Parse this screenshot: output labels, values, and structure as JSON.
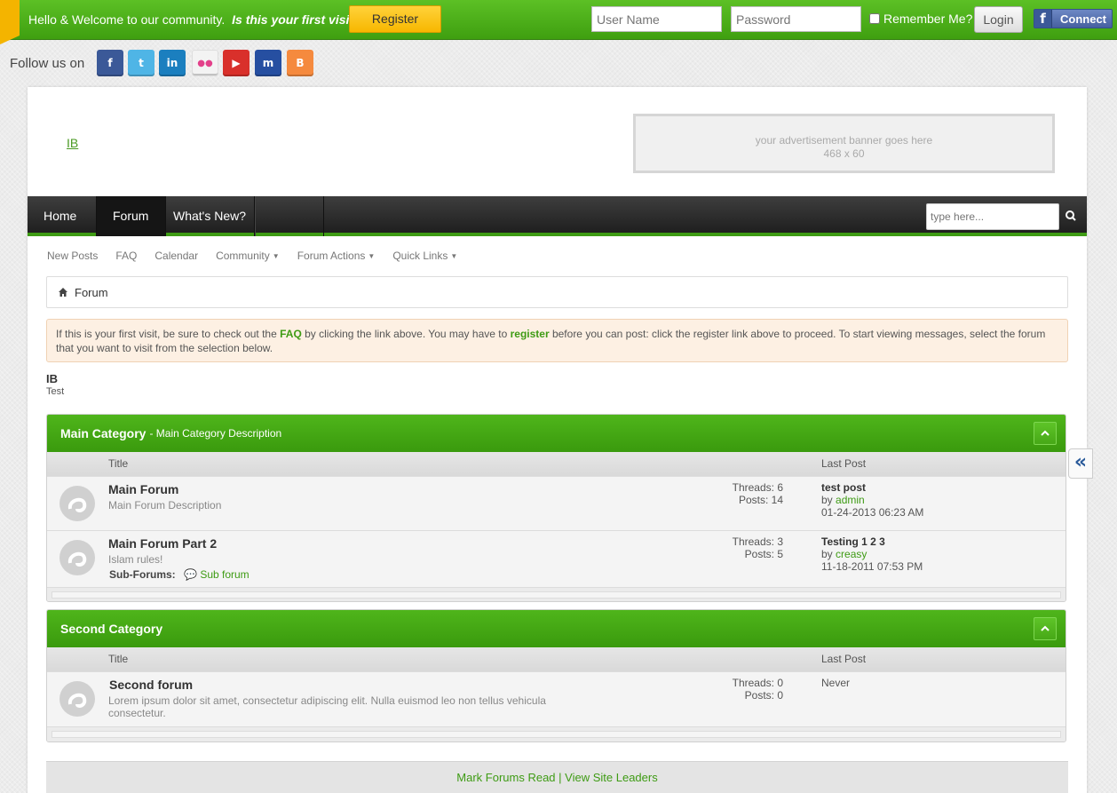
{
  "topbar": {
    "welcome": "Hello & Welcome to our community.",
    "first_visit": "Is this your first visit?",
    "register_label": "Register",
    "username_placeholder": "User Name",
    "password_placeholder": "Password",
    "remember_label": "Remember Me?",
    "remember_checked": false,
    "login_label": "Login",
    "fb_connect_label": "Connect",
    "fb_icon": "f"
  },
  "follow": {
    "label": "Follow us on",
    "networks": [
      {
        "name": "facebook",
        "glyph": "f",
        "color": "#3b5998"
      },
      {
        "name": "twitter",
        "glyph": "t",
        "color": "#4fb5e6"
      },
      {
        "name": "linkedin",
        "glyph": "in",
        "color": "#1b7fbf"
      },
      {
        "name": "flickr",
        "glyph": "●●",
        "color": "#f3f3f3"
      },
      {
        "name": "youtube",
        "glyph": "▶",
        "color": "#d9302b"
      },
      {
        "name": "myspace",
        "glyph": "m",
        "color": "#264fa1"
      },
      {
        "name": "blogger",
        "glyph": "B",
        "color": "#f58a3e"
      }
    ]
  },
  "header": {
    "logo_text": "IB",
    "ad_line1": "your advertisement banner goes here",
    "ad_line2": "468 x 60"
  },
  "nav": {
    "tabs": [
      "Home",
      "Forum",
      "What's New?"
    ],
    "selected_tab": "Forum",
    "search_placeholder": "type here..."
  },
  "subnav": {
    "links": [
      "New Posts",
      "FAQ",
      "Calendar",
      "Community",
      "Forum Actions",
      "Quick Links"
    ]
  },
  "breadcrumb": {
    "current": "Forum"
  },
  "notice": {
    "part1": "If this is your first visit, be sure to check out the ",
    "faq_link": "FAQ",
    "part2": " by clicking the link above. You may have to ",
    "register_link": "register",
    "part3": " before you can post: click the register link above to proceed. To start viewing messages, select the forum that you want to visit from the selection below."
  },
  "site": {
    "title": "IB",
    "description": "Test"
  },
  "categories": [
    {
      "title": "Main Category",
      "description": "- Main Category Description",
      "col_title": "Title",
      "col_last_post": "Last Post",
      "forums": [
        {
          "name": "Main Forum",
          "description": "Main Forum Description",
          "threads": "Threads: 6",
          "posts": "Posts: 14",
          "last_title": "test post",
          "last_by": "by",
          "last_user": "admin",
          "last_date": "01-24-2013 06:23 AM"
        },
        {
          "name": "Main Forum Part 2",
          "description": "Islam rules!",
          "subforums_label": "Sub-Forums:",
          "subforum": "Sub forum",
          "threads": "Threads: 3",
          "posts": "Posts: 5",
          "last_title": "Testing 1 2 3",
          "last_by": "by",
          "last_user": "creasy",
          "last_date": "11-18-2011 07:53 PM"
        }
      ]
    },
    {
      "title": "Second Category",
      "col_title": "Title",
      "col_last_post": "Last Post",
      "forums": [
        {
          "name": "Second forum",
          "description": "Lorem ipsum dolor sit amet, consectetur adipiscing elit. Nulla euismod leo non tellus vehicula consectetur.",
          "threads": "Threads: 0",
          "posts": "Posts: 0",
          "last_never": "Never"
        }
      ]
    }
  ],
  "footer": {
    "mark_read": "Mark Forums Read",
    "separator": "|",
    "site_leaders": "View Site Leaders"
  },
  "side_toggle": "«",
  "colors": {
    "accent": "#3e9b14",
    "header_green": "#4fb51b",
    "register_yellow": "#f7b700",
    "nav_dark": "#1f1f1f"
  }
}
